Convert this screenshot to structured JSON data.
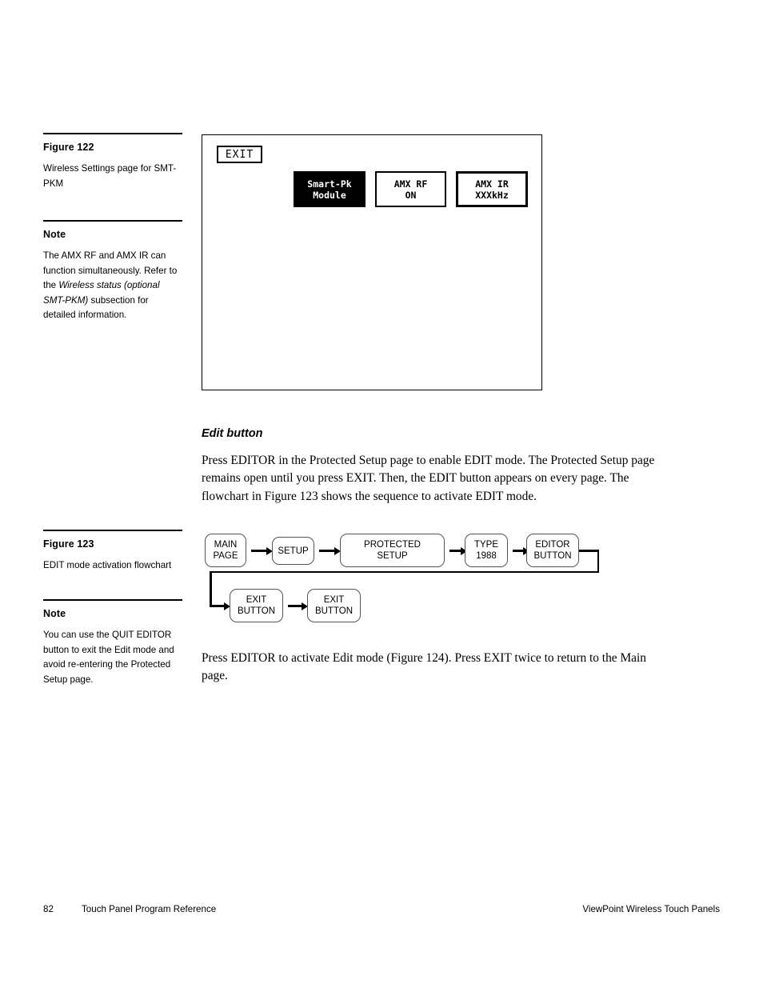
{
  "sidebar": {
    "figure122": {
      "heading": "Figure 122",
      "caption": "Wireless Settings page for SMT-PKM"
    },
    "note1": {
      "heading": "Note",
      "text_part1": "The AMX RF and AMX IR can function simultaneously. Refer to the ",
      "text_italic1": "Wireless status (optional SMT-PKM)",
      "text_part2": " subsection for detailed information."
    },
    "figure123": {
      "heading": "Figure 123",
      "caption": "EDIT mode activation flowchart"
    },
    "note2": {
      "heading": "Note",
      "text": "You can use the QUIT EDITOR button to exit the Edit mode and avoid re-entering the Protected Setup page."
    }
  },
  "figure_panel": {
    "exit_button": "EXIT",
    "smartpk_button": {
      "line1": "Smart-Pk",
      "line2": "Module"
    },
    "amxrf_button": {
      "line1": "AMX RF",
      "line2": "ON"
    },
    "amxir_button": {
      "line1": "AMX IR",
      "line2": "XXXkHz"
    }
  },
  "main": {
    "section_heading": "Edit button",
    "para_edit": "Press EDITOR in the Protected Setup page to enable EDIT mode. The Protected Setup page remains open until you press EXIT. Then, the EDIT button appears on every page. The flowchart in Figure 123 shows the sequence to activate EDIT mode.",
    "para_press": "Press EDITOR to activate Edit mode (Figure 124). Press EXIT twice to return to the Main page."
  },
  "flowchart": {
    "nodes": [
      {
        "line1": "MAIN",
        "line2": "PAGE"
      },
      {
        "line1": "SETUP",
        "line2": ""
      },
      {
        "line1": "PROTECTED",
        "line2": "SETUP"
      },
      {
        "line1": "TYPE",
        "line2": "1988"
      },
      {
        "line1": "EDITOR",
        "line2": "BUTTON"
      },
      {
        "line1": "EXIT",
        "line2": "BUTTON"
      },
      {
        "line1": "EXIT",
        "line2": "BUTTON"
      }
    ]
  },
  "footer": {
    "page_number": "82",
    "left_title": "Touch Panel Program Reference",
    "right_title": "ViewPoint Wireless Touch Panels"
  }
}
